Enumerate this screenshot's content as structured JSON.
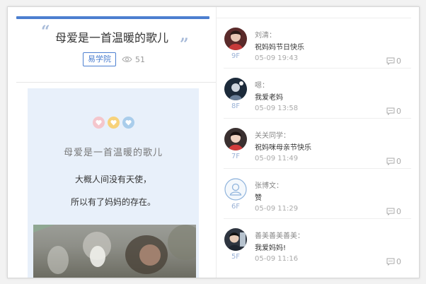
{
  "article": {
    "title": "母爱是一首温暖的歌儿",
    "tag": "易学院",
    "views": "51",
    "quote_open": "“",
    "quote_close": "”"
  },
  "card": {
    "title": "母爱是一首温暖的歌儿",
    "line1": "大概人间没有天使，",
    "line2": "所以有了妈妈的存在。",
    "heart_colors": [
      "#f4c6cc",
      "#f7d27a",
      "#a9cdeb"
    ]
  },
  "comments": [
    {
      "name": "刘清：",
      "text": "祝妈妈节日快乐",
      "time": "05-09 19:43",
      "floor": "9F",
      "replies": "0",
      "avatar": "avatar-photo"
    },
    {
      "name": "嗯：",
      "text": "我爱老妈",
      "time": "05-09 13:58",
      "floor": "8F",
      "replies": "0",
      "avatar": "avatar-photo"
    },
    {
      "name": "关关同学：",
      "text": "祝妈咪母亲节快乐",
      "time": "05-09 11:49",
      "floor": "7F",
      "replies": "0",
      "avatar": "avatar-photo"
    },
    {
      "name": "张博文：",
      "text": "赞",
      "time": "05-09 11:29",
      "floor": "6F",
      "replies": "0",
      "avatar": "default-user-icon"
    },
    {
      "name": "善美善美善美：",
      "text": "我爱妈妈!",
      "time": "05-09 11:16",
      "floor": "5F",
      "replies": "0",
      "avatar": "avatar-photo"
    }
  ],
  "colors": {
    "accent": "#4c7fd0",
    "floor": "#9ab2d6"
  }
}
